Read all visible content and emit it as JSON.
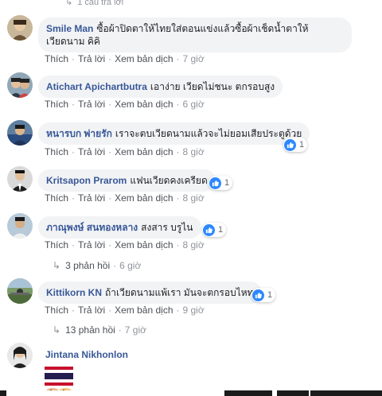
{
  "top_reply": {
    "count_text": "1 câu trả lời"
  },
  "actions": {
    "like": "Thích",
    "reply": "Trả lời",
    "translate": "Xem bản dịch",
    "sep": "·"
  },
  "comments": [
    {
      "author": "Smile Man",
      "text": "ซื้อผ้าปิดตาให้ไทยใส่ตอนแข่งแล้วซื้อผ้าเช็ดน้ำตาให้เวียดนาม คิคิ",
      "time": "7 giờ"
    },
    {
      "author": "Atichart Apichartbutra",
      "text": "เอาง่าย เวียดไม่ชนะ ตกรอบสูง",
      "time": "6 giờ"
    },
    {
      "author": "หนารบก พ่ายรัก",
      "text": "เราจะตบเวียดนามแล้วจะไม่ยอมเสียประตูด้วย",
      "time": "8 giờ",
      "reactions": "1"
    },
    {
      "author": "Kritsapon Prarom",
      "text": "แฟนเวียดคงเครียด",
      "time": "8 giờ",
      "reactions": "1"
    },
    {
      "author": "ภาณุพงษ์ สนทองหลาง",
      "text": "สงสาร บรูไน",
      "time": "8 giờ",
      "reactions": "1",
      "replies": "3 phản hồi",
      "replies_time": "6 giờ"
    },
    {
      "author": "Kittikorn KN",
      "text": "ถ้าเวียดนามแพ้เรา มันจะตกรอบไหท",
      "time": "9 giờ",
      "reactions": "1",
      "replies": "13 phản hồi",
      "replies_time": "7 giờ"
    },
    {
      "author": "Jintana Nikhonlon"
    }
  ],
  "colors": {
    "author": "#385898",
    "bubble": "#f2f3f5",
    "like": "#2d88ff",
    "muted": "#90949c"
  }
}
